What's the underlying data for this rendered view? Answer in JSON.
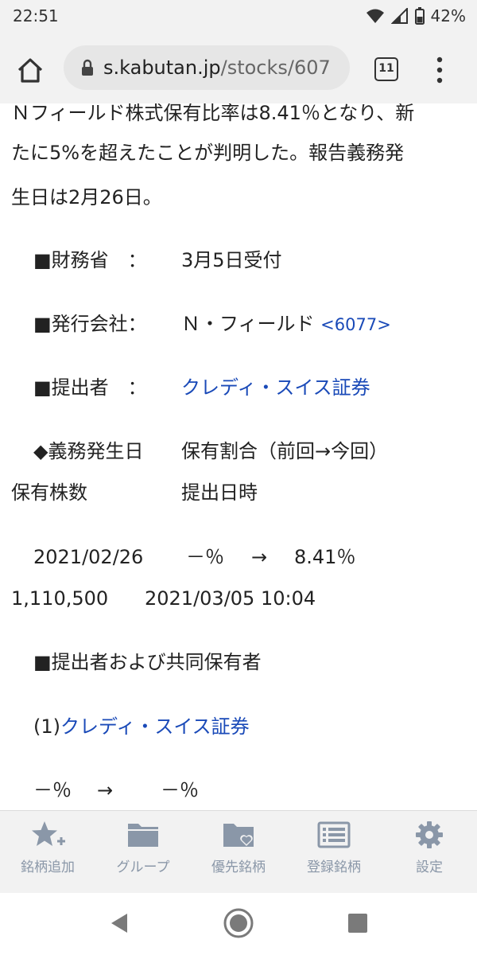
{
  "status_bar": {
    "time": "22:51",
    "battery": "42%",
    "icons": [
      "wifi-icon",
      "signal-icon",
      "battery-icon"
    ]
  },
  "browser": {
    "url_domain": "s.kabutan.jp",
    "url_path": "/stocks/607",
    "tab_count": "11",
    "icons": [
      "home-icon",
      "lock-icon",
      "tabs-icon",
      "more-menu-icon"
    ]
  },
  "article": {
    "partial_top": "Ｎフィールド株式保有比率は8.41％となり、新",
    "line2": "たに5%を超えたことが判明した。報告義務発",
    "line3": "生日は2月26日。",
    "ministry_label": "■財務省　：",
    "ministry_value": "3月5日受付",
    "issuer_label": "■発行会社：",
    "issuer_value": "Ｎ・フィールド",
    "issuer_code": "<6077>",
    "filer_label": "■提出者　：",
    "filer_value": "クレディ・スイス証券",
    "header_col1": "◆義務発生日",
    "header_col2": "保有割合（前回→今回）",
    "header_col3": "保有株数",
    "header_col4": "提出日時",
    "row_date": "2021/02/26",
    "row_prev": "－％",
    "row_arrow": "→",
    "row_curr": "8.41％",
    "row_shares": "1,110,500",
    "row_submitted": "2021/03/05 10:04",
    "joint_title": "■提出者および共同保有者",
    "joint_index": "(1)",
    "joint_name": "クレディ・スイス証券",
    "joint_prev": "－％",
    "joint_arrow": "→",
    "joint_curr": "－％"
  },
  "tab_bar": {
    "items": [
      {
        "label": "銘柄追加",
        "icon": "star-plus-icon"
      },
      {
        "label": "グループ",
        "icon": "folder-icon"
      },
      {
        "label": "優先銘柄",
        "icon": "folder-heart-icon"
      },
      {
        "label": "登録銘柄",
        "icon": "list-icon"
      },
      {
        "label": "設定",
        "icon": "gear-icon"
      }
    ],
    "icon_color": "#8a97a8"
  },
  "nav_bar": {
    "icons": [
      "back-icon",
      "home-circle-icon",
      "recents-icon"
    ]
  },
  "colors": {
    "link": "#1a4ab8",
    "bar_bg": "#f2f2f2"
  }
}
